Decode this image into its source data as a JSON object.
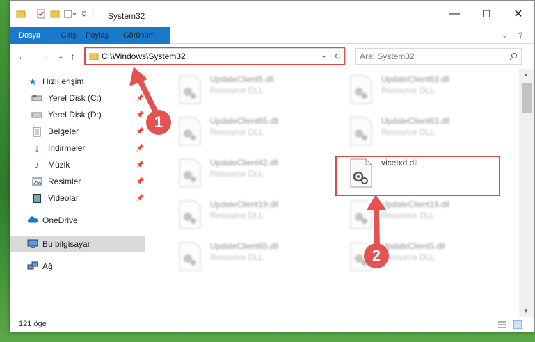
{
  "window": {
    "title": "System32",
    "minimize": "—",
    "maximize": "☐",
    "close": "✕"
  },
  "ribbon": {
    "tabs": [
      "Dosya",
      "Giriş",
      "Paylaş",
      "Görünüm"
    ],
    "help": "?"
  },
  "address": {
    "path": "C:\\Windows\\System32",
    "search_placeholder": "Ara: System32"
  },
  "sidebar": {
    "items": [
      {
        "label": "Hızlı erişim",
        "icon": "star-icon"
      },
      {
        "label": "Yerel Disk (C:)",
        "icon": "drive-icon"
      },
      {
        "label": "Yerel Disk (D:)",
        "icon": "drive-icon"
      },
      {
        "label": "Belgeler",
        "icon": "documents-icon"
      },
      {
        "label": "İndirmeler",
        "icon": "download-icon"
      },
      {
        "label": "Müzik",
        "icon": "music-icon"
      },
      {
        "label": "Resimler",
        "icon": "pictures-icon"
      },
      {
        "label": "Videolar",
        "icon": "video-icon"
      },
      {
        "label": "OneDrive",
        "icon": "cloud-icon"
      },
      {
        "label": "Bu bilgisayar",
        "icon": "computer-icon"
      },
      {
        "label": "Ağ",
        "icon": "network-icon"
      }
    ]
  },
  "files": [
    {
      "name": "UpdateClient5.dll",
      "type": "Resource DLL"
    },
    {
      "name": "UpdateClient63.dll",
      "type": "Resource DLL"
    },
    {
      "name": "UpdateClient65.dll",
      "type": "Resource DLL"
    },
    {
      "name": "UpdateClient63.dll",
      "type": "Resource DLL"
    },
    {
      "name": "UpdateClient42.dll",
      "type": "Resource DLL"
    },
    {
      "name": "vicetxd.dll",
      "type": ""
    },
    {
      "name": "UpdateClient19.dll",
      "type": "Resource DLL"
    },
    {
      "name": "UpdateClient19.dll",
      "type": "Resource DLL"
    },
    {
      "name": "UpdateClient65.dll",
      "type": "Resource DLL"
    },
    {
      "name": "UpdateClient5.dll",
      "type": "Resource DLL"
    }
  ],
  "status": {
    "count": "121 öge"
  },
  "annotations": {
    "step1": "1",
    "step2": "2",
    "color": "#e04747"
  }
}
